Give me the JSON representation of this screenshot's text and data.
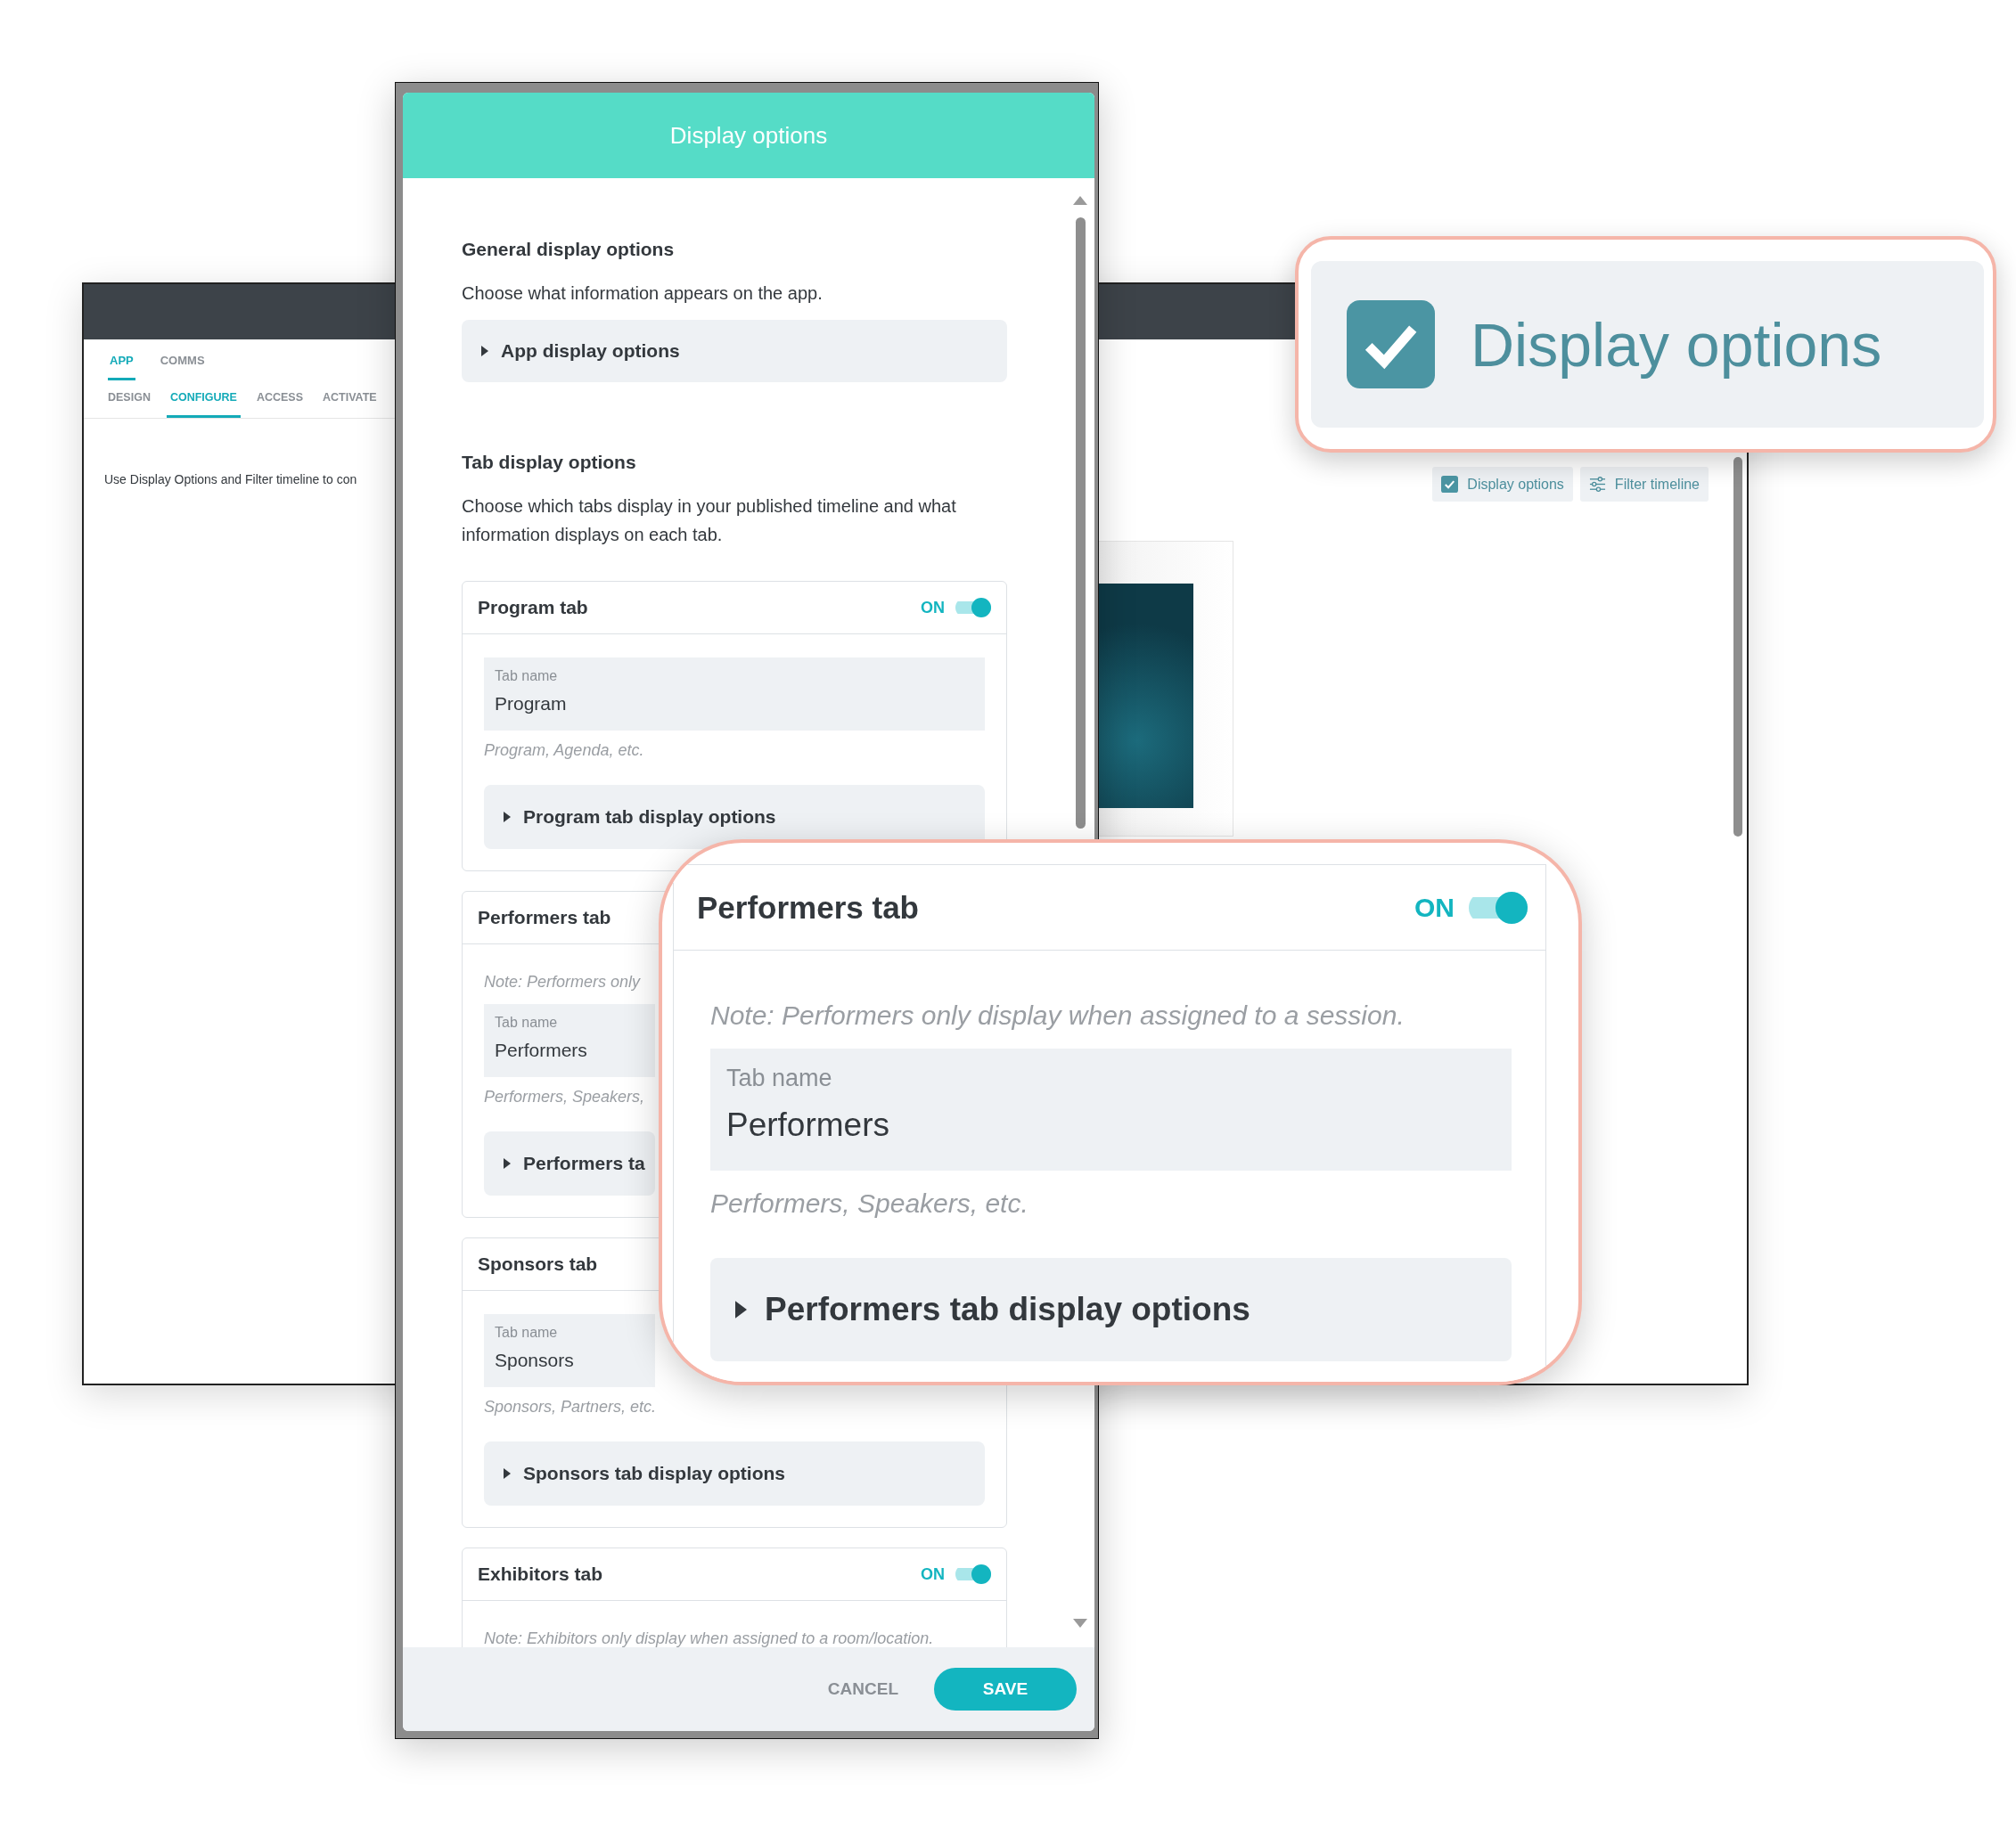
{
  "back_window": {
    "top_tabs": [
      {
        "label": "APP",
        "selected": true
      },
      {
        "label": "COMMS",
        "selected": false
      }
    ],
    "sub_tabs": [
      {
        "label": "DESIGN",
        "selected": false
      },
      {
        "label": "CONFIGURE",
        "selected": true
      },
      {
        "label": "ACCESS",
        "selected": false
      },
      {
        "label": "ACTIVATE",
        "selected": false
      }
    ],
    "intro_text": "Use Display Options and Filter timeline to con",
    "toolbar": [
      {
        "kind": "checkbox",
        "label": "Display options",
        "checked": true
      },
      {
        "kind": "filter",
        "label": "Filter timeline"
      }
    ]
  },
  "modal": {
    "title": "Display options",
    "general": {
      "heading": "General display options",
      "description": "Choose what information appears on the app.",
      "accordion": "App display options"
    },
    "tab_section": {
      "heading": "Tab display options",
      "description": "Choose which tabs display in your published timeline and what information displays on each tab."
    },
    "tab_cards": [
      {
        "title": "Program tab",
        "toggle": {
          "label": "ON",
          "on": true
        },
        "field": {
          "label": "Tab name",
          "value": "Program"
        },
        "hint": "Program, Agenda, etc.",
        "accordion": "Program tab display options"
      },
      {
        "title": "Performers tab",
        "note": "Note: Performers only",
        "field": {
          "label": "Tab name",
          "value": "Performers"
        },
        "hint": "Performers, Speakers,",
        "accordion": "Performers ta"
      },
      {
        "title": "Sponsors tab",
        "field": {
          "label": "Tab name",
          "value": "Sponsors"
        },
        "hint": "Sponsors, Partners, etc.",
        "accordion": "Sponsors tab display options"
      },
      {
        "title": "Exhibitors tab",
        "toggle": {
          "label": "ON",
          "on": true
        },
        "note": "Note: Exhibitors only display when assigned to a room/location."
      }
    ],
    "cancel_button": "CANCEL",
    "save_button": "SAVE"
  },
  "zoom_callouts": [
    {
      "kind": "checkbox",
      "label": "Display options",
      "checked": true
    },
    {
      "kind": "tab_card",
      "title": "Performers tab",
      "toggle": {
        "label": "ON",
        "on": true
      },
      "note": "Note: Performers only display when assigned to a session.",
      "field": {
        "label": "Tab name",
        "value": "Performers"
      },
      "hint": "Performers, Speakers, etc.",
      "accordion": "Performers tab display options"
    }
  ]
}
